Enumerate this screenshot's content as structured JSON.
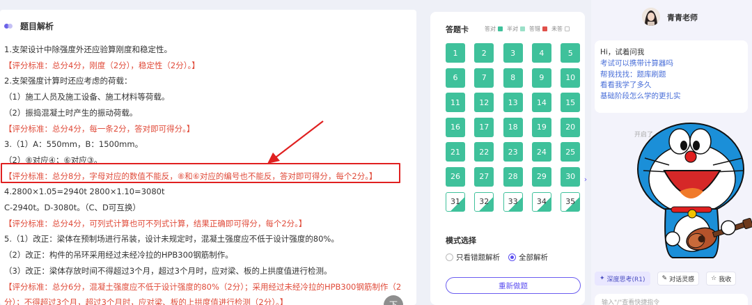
{
  "analysis": {
    "title": "题目解析",
    "lines": [
      {
        "text": "1.支架设计中除强度外还应验算刚度和稳定性。",
        "red": false
      },
      {
        "text": "【评分标准：总分4分，刚度（2分），稳定性（2分）。】",
        "red": true
      },
      {
        "text": "2.支架强度计算时还应考虑的荷载：",
        "red": false
      },
      {
        "text": "（1）施工人员及施工设备、施工材料等荷载。",
        "red": false
      },
      {
        "text": "（2）振捣混凝土时产生的振动荷载。",
        "red": false
      },
      {
        "text": "【评分标准：总分4分，每一条2分，答对即可得分。】",
        "red": true
      },
      {
        "text": "3.（1）A：550mm，B：1500mm。",
        "red": false
      },
      {
        "text": "（2）⑧对应④；⑥对应③。",
        "red": false
      },
      {
        "text": "【评分标准：总分8分，字母对应的数值不能反，⑧和⑥对应的编号也不能反，答对即可得分，每个2分。】",
        "red": true
      },
      {
        "text": "4.2800×1.05=2940t    2800×1.10=3080t",
        "red": false
      },
      {
        "text": "C-2940t。D-3080t。（C、D可互换）",
        "red": false
      },
      {
        "text": "【评分标准：总分4分，可列式计算也可不列式计算，结果正确即可得分，每个2分。】",
        "red": true
      },
      {
        "text": "5.（1）改正：梁体在预制场进行吊装，设计未规定时，混凝土强度应不低于设计强度的80%。",
        "red": false
      },
      {
        "text": "（2）改正：构件的吊环采用经过未经冷拉的HPB300钢筋制作。",
        "red": false
      },
      {
        "text": "（3）改正：梁体存放时间不得超过3个月，超过3个月时，应对梁、板的上拱度值进行检测。",
        "red": false
      },
      {
        "text": "【评分标准：总分6分，混凝土强度应不低于设计强度的80%（2分）；采用经过未经冷拉的HPB300钢筋制作（2分）；不得超过3个月，超过3个月时，应对梁、板的上拱度值进行检测（2分）。】",
        "red": true,
        "wrap": true
      }
    ],
    "scroll_button": "下"
  },
  "answer_card": {
    "title": "答题卡",
    "legend": [
      {
        "label": "答对",
        "color": "#3fc19b"
      },
      {
        "label": "半对",
        "color": "#9be0c8"
      },
      {
        "label": "答错",
        "color": "#e0504a"
      },
      {
        "label": "未答",
        "color": "#ffffff"
      }
    ],
    "cells": [
      "1",
      "2",
      "3",
      "4",
      "5",
      "6",
      "7",
      "8",
      "9",
      "10",
      "11",
      "12",
      "13",
      "14",
      "15",
      "16",
      "17",
      "18",
      "19",
      "20",
      "21",
      "22",
      "23",
      "24",
      "25",
      "26",
      "27",
      "28",
      "29",
      "30",
      "31",
      "32",
      "33",
      "34",
      "35"
    ],
    "half_from": 31,
    "mode_title": "模式选择",
    "mode_options": [
      "只看错题解析",
      "全部解析"
    ],
    "mode_selected": "全部解析",
    "redo_label": "重新做题",
    "collapse_glyph": "›"
  },
  "assistant": {
    "name": "青青老师",
    "greeting": "Hi，试着问我",
    "suggestions": [
      "考试可以携带计算器吗",
      "帮我找找：题库刷题",
      "看看我学了多久",
      "基础阶段怎么学的更扎实"
    ],
    "divider": "开启了",
    "chips": [
      "深度思考(R1)",
      "对话灵感",
      "我收"
    ],
    "input_placeholder": "输入\"/\"查看快捷指令"
  }
}
